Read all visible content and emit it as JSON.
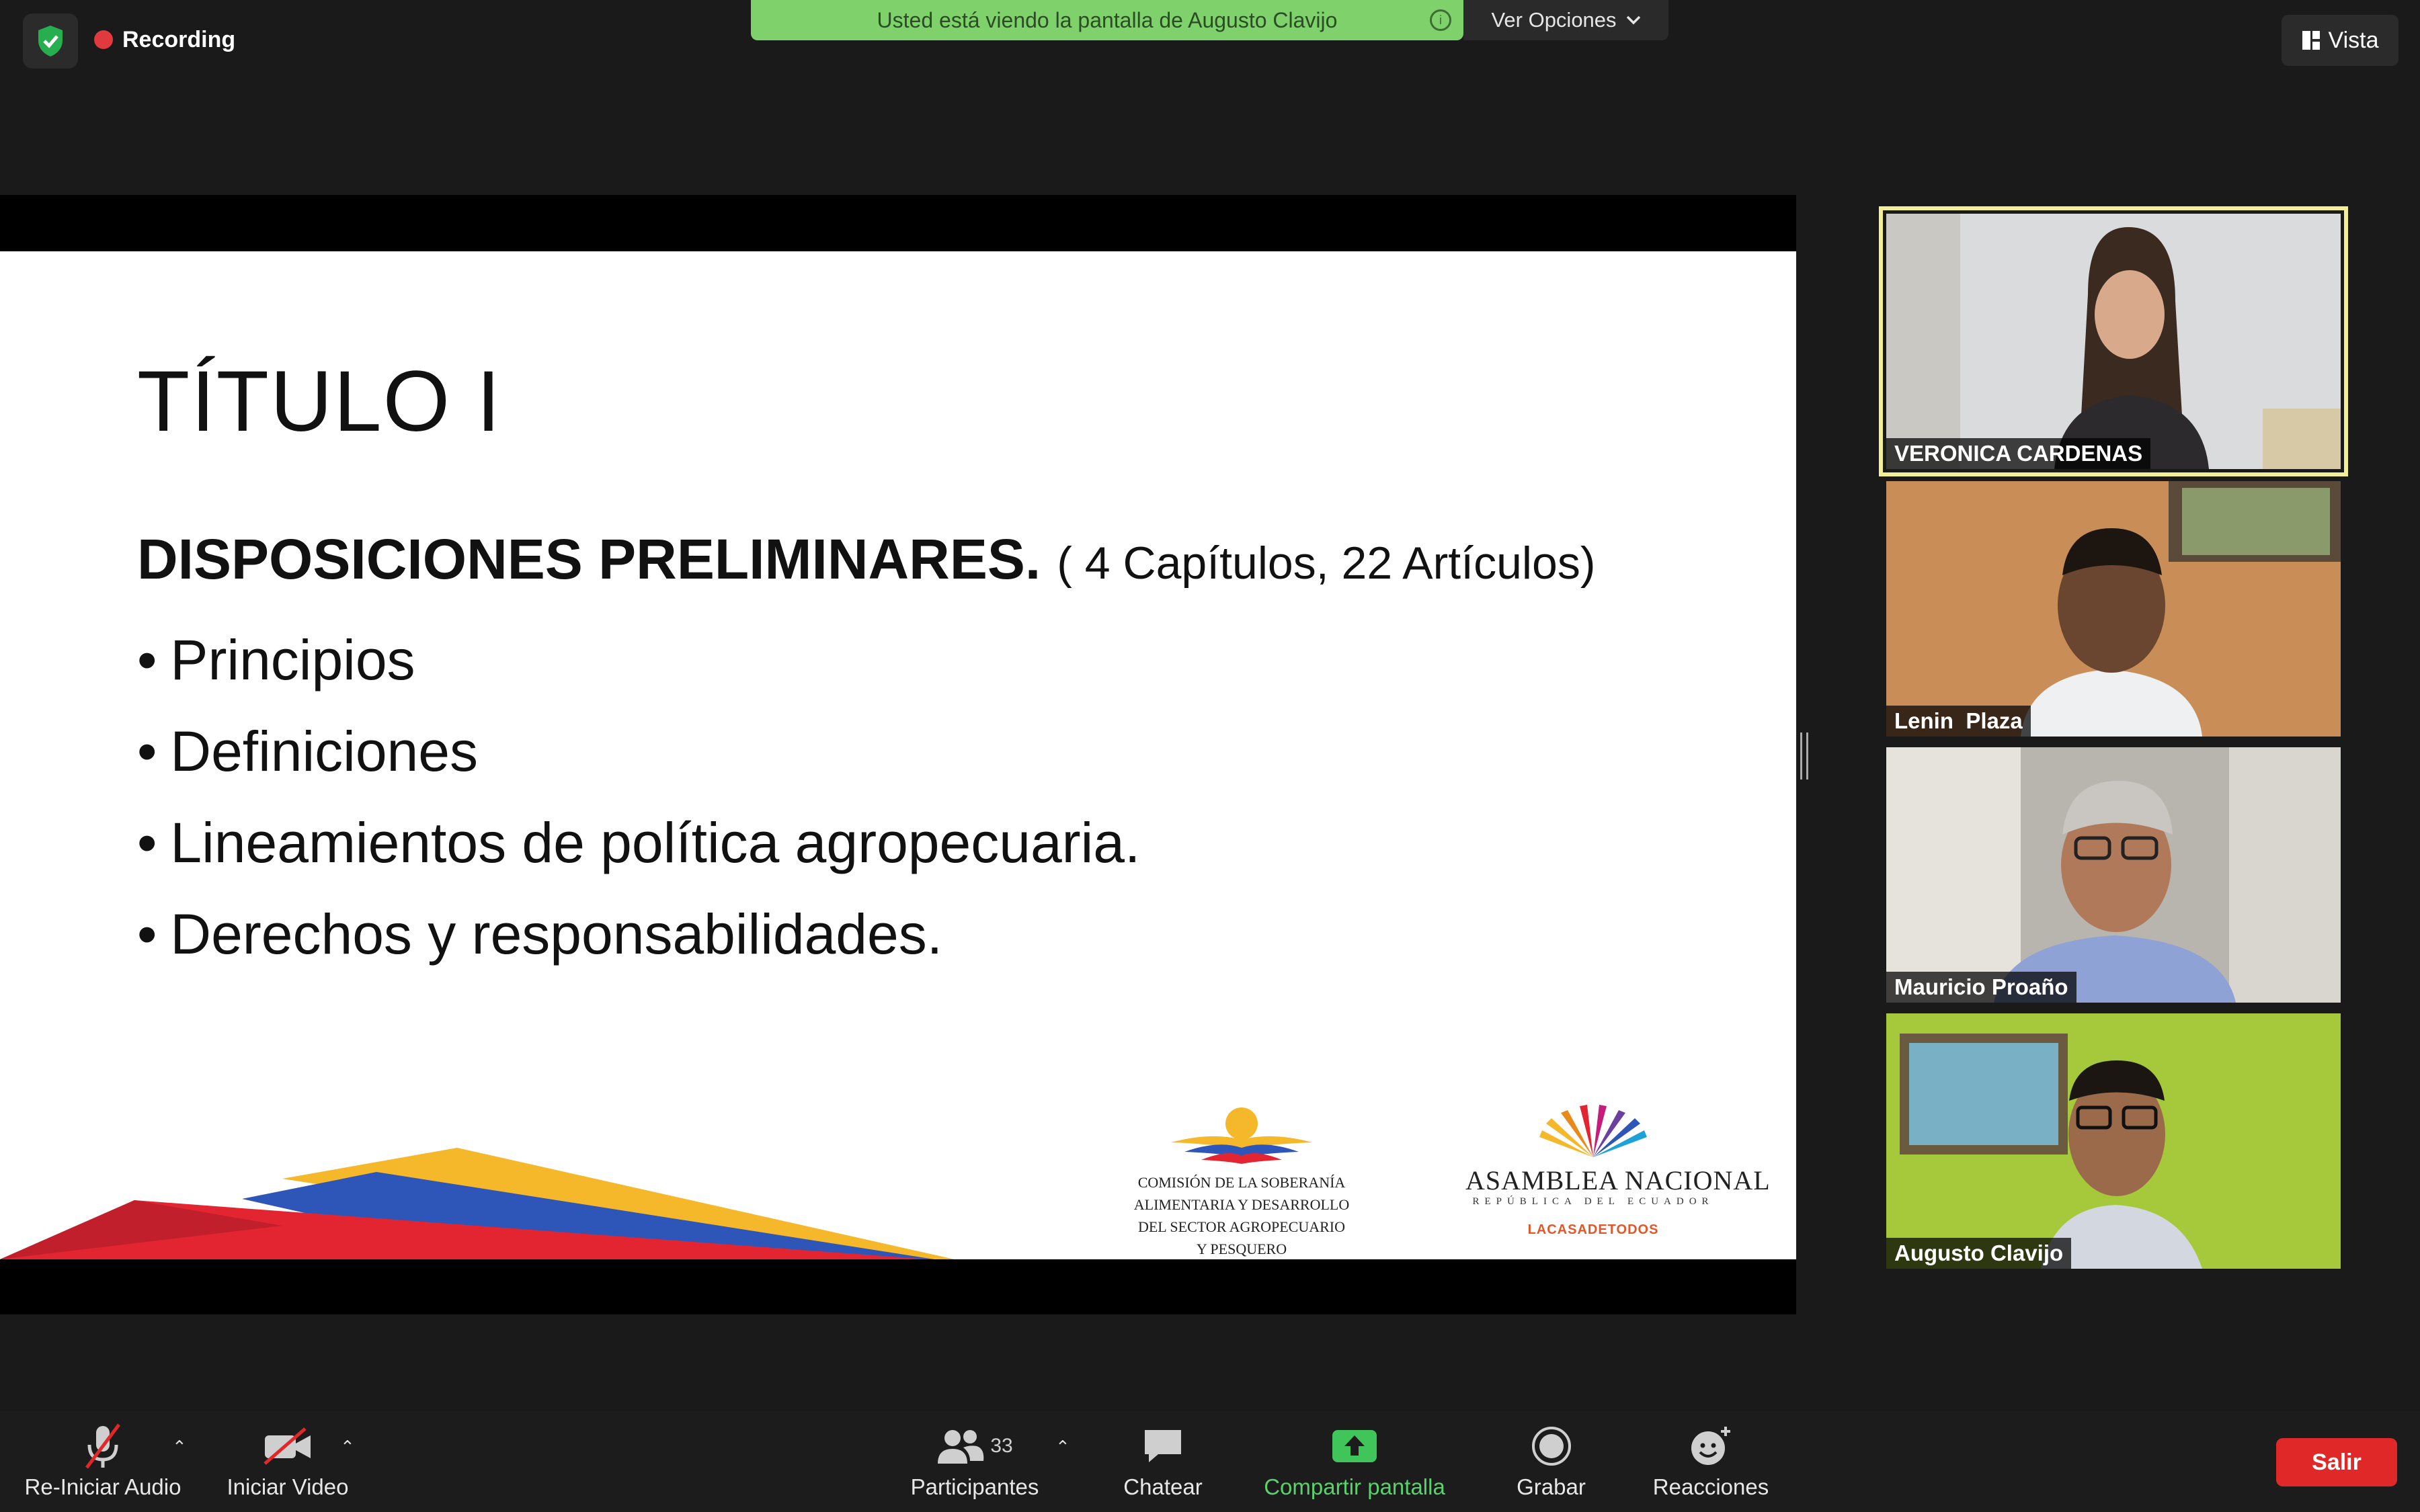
{
  "top_bar": {
    "recording_label": "Recording",
    "share_banner_text": "Usted está viendo la pantalla de Augusto Clavijo",
    "view_options_label": "Ver Opciones",
    "view_label": "Vista"
  },
  "slide": {
    "title": "TÍTULO I",
    "subtitle": "DISPOSICIONES PRELIMINARES.",
    "subtitle_note": "( 4 Capítulos, 22 Artículos)",
    "bullets": [
      "Principios",
      "Definiciones",
      "Lineamientos de política agropecuaria.",
      "Derechos y responsabilidades."
    ],
    "logo_comision_lines": [
      "COMISIÓN DE LA SOBERANÍA",
      "ALIMENTARIA Y DESARROLLO",
      "DEL SECTOR AGROPECUARIO",
      "Y PESQUERO"
    ],
    "logo_asamblea_name": "ASAMBLEA NACIONAL",
    "logo_asamblea_sub": "REPÚBLICA DEL ECUADOR",
    "logo_asamblea_tag": "LACASADETODOS"
  },
  "participants": [
    {
      "name": "VERONICA CARDENAS",
      "active_speaker": true
    },
    {
      "name": "Lenin  Plaza",
      "active_speaker": false
    },
    {
      "name": "Mauricio Proaño",
      "active_speaker": false
    },
    {
      "name": "Augusto Clavijo",
      "active_speaker": false
    }
  ],
  "toolbar": {
    "audio_label": "Re-Iniciar Audio",
    "video_label": "Iniciar Video",
    "participants_label": "Participantes",
    "participants_count": "33",
    "chat_label": "Chatear",
    "share_label": "Compartir pantalla",
    "record_label": "Grabar",
    "reactions_label": "Reacciones",
    "leave_label": "Salir"
  },
  "colors": {
    "share_banner": "#7fd16b",
    "active_speaker_border": "#f2ef95",
    "leave_button": "#e02828",
    "recording_dot": "#e0393e"
  }
}
